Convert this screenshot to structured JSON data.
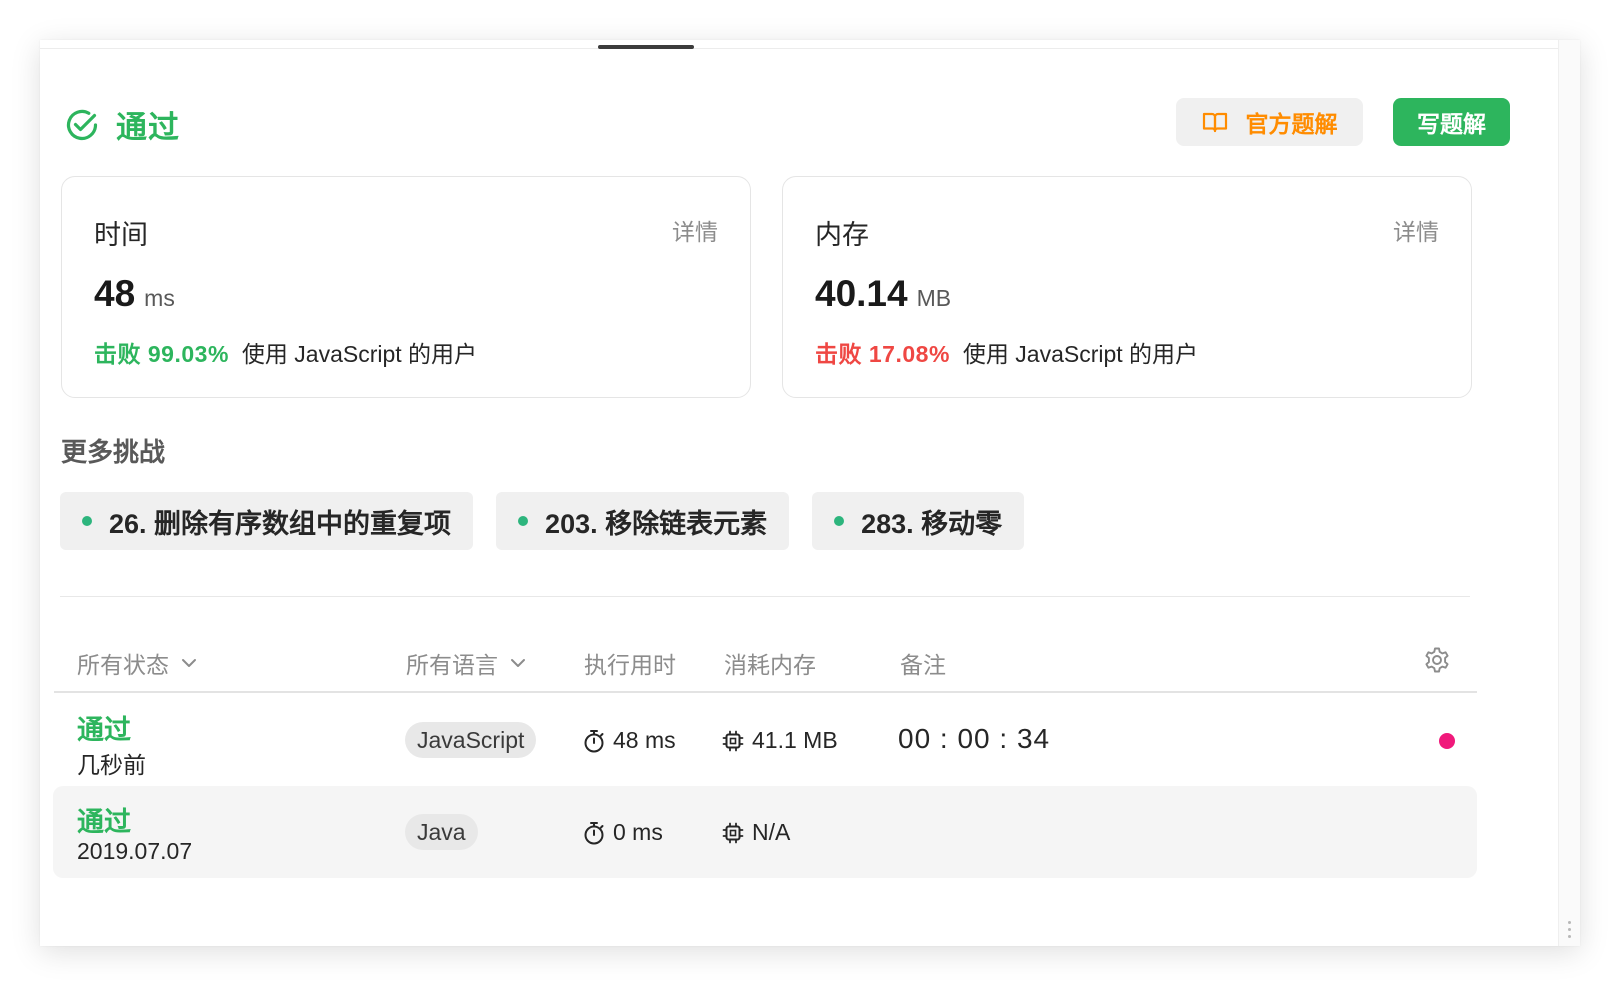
{
  "header": {
    "status_title": "通过",
    "official_solution_label": "官方题解",
    "write_solution_label": "写题解"
  },
  "cards": {
    "time": {
      "title": "时间",
      "detail_label": "详情",
      "value": "48",
      "unit": "ms",
      "beat_label": "击败 99.03%",
      "beat_suffix": "使用 JavaScript 的用户"
    },
    "memory": {
      "title": "内存",
      "detail_label": "详情",
      "value": "40.14",
      "unit": "MB",
      "beat_label": "击败 17.08%",
      "beat_suffix": "使用 JavaScript 的用户"
    }
  },
  "more_challenges": {
    "title": "更多挑战",
    "items": [
      {
        "label": "26. 删除有序数组中的重复项"
      },
      {
        "label": "203. 移除链表元素"
      },
      {
        "label": "283. 移动零"
      }
    ]
  },
  "table": {
    "headers": {
      "status": "所有状态",
      "language": "所有语言",
      "runtime": "执行用时",
      "memory": "消耗内存",
      "notes": "备注"
    },
    "rows": [
      {
        "status": "通过",
        "time": "几秒前",
        "language": "JavaScript",
        "runtime": "48 ms",
        "memory": "41.1 MB",
        "note": "00 : 00 : 34"
      },
      {
        "status": "通过",
        "time": "2019.07.07",
        "language": "Java",
        "runtime": "0 ms",
        "memory": "N/A",
        "note": ""
      }
    ]
  },
  "icons": {
    "status": "check-circle-icon",
    "official_solution": "book-icon",
    "settings": "gear-icon",
    "runtime": "stopwatch-icon",
    "memory": "chip-icon",
    "dropdown": "chevron-down-icon"
  },
  "colors": {
    "accent_green": "#2db55d",
    "accent_orange": "#ff8c00",
    "beat_red": "#ef4743",
    "note_dot": "#f0197b"
  }
}
